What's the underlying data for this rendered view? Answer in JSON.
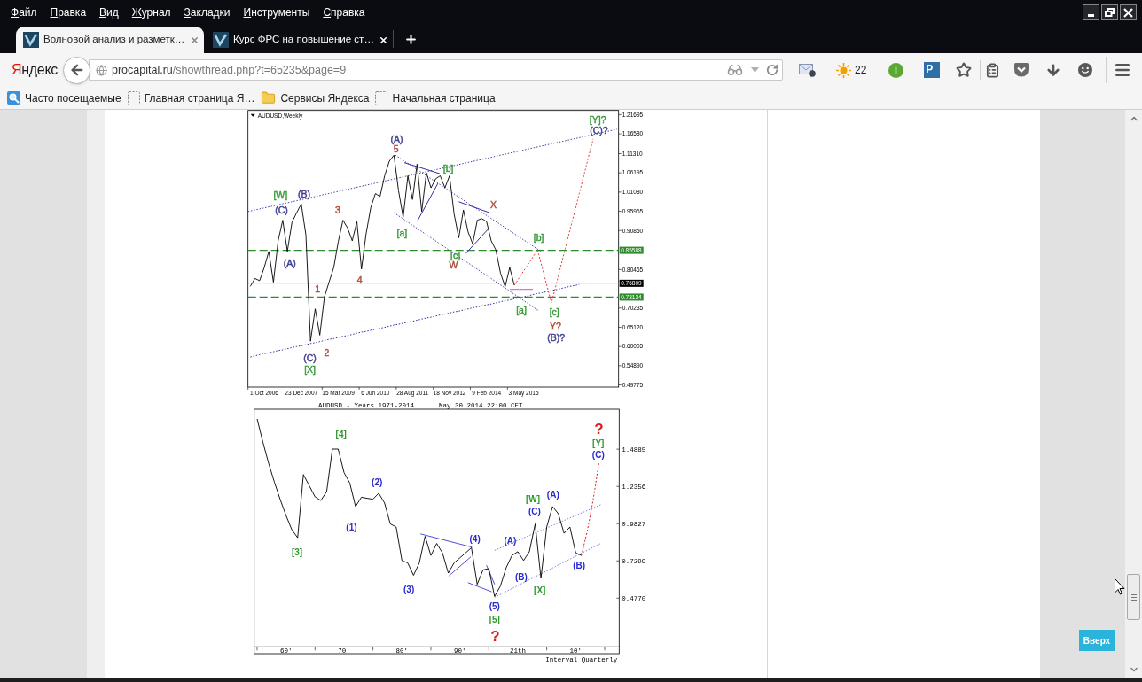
{
  "menu_bar": {
    "items": [
      "Файл",
      "Правка",
      "Вид",
      "Журнал",
      "Закладки",
      "Инструменты",
      "Справка"
    ]
  },
  "tabs": [
    {
      "title": "Волновой анализ и разметк…",
      "selected": true
    },
    {
      "title": "Курс ФРС на повышение ст…",
      "selected": false
    }
  ],
  "nav_bar": {
    "logo": "Яндекс",
    "url_host": "procapital.ru",
    "url_path": "/showthread.php?t=65235&page=9",
    "weather_temperature": "22",
    "extension_letter": "P"
  },
  "bookmarks": [
    {
      "label": "Часто посещаемые",
      "kind": "smart"
    },
    {
      "label": "Главная страница Я…",
      "kind": "page"
    },
    {
      "label": "Сервисы Яндекса",
      "kind": "folder"
    },
    {
      "label": "Начальная страница",
      "kind": "page"
    }
  ],
  "post": {
    "charts": [
      {
        "kind": "terminal",
        "chart_data": {
          "type": "line",
          "title": "AUDUSD,Weekly",
          "categories": [
            null,
            null,
            null,
            "1 Oct 2006",
            null,
            null,
            null,
            null,
            null,
            null,
            null,
            "23 Dec 2007",
            null,
            null,
            null,
            null,
            null,
            null,
            null,
            "15 Mar 2009",
            null,
            null,
            null,
            null,
            null,
            null,
            null,
            "6 Jun 2010",
            null,
            null,
            null,
            null,
            null,
            null,
            null,
            "28 Aug 2011",
            null,
            null,
            null,
            null,
            null,
            null,
            null,
            "18 Nov 2012",
            null,
            null,
            null,
            null,
            null,
            null,
            null,
            "9 Feb 2014",
            null,
            null,
            null,
            null,
            null,
            null,
            null,
            "3 May 2015",
            null,
            null,
            null,
            null,
            null,
            null,
            null,
            null,
            null,
            null,
            null,
            null,
            null,
            null,
            null,
            null,
            null,
            null,
            null,
            null
          ],
          "series": [
            {
              "color": "#000000",
              "line_style": "solid",
              "values": [
                0.76,
                0.781,
                0.775,
                0.81,
                0.853,
                0.771,
                0.881,
                0.936,
                0.853,
                0.93,
                0.956,
                0.979,
                0.897,
                0.614,
                0.7,
                0.63,
                0.732,
                0.771,
                0.81,
                0.88,
                0.936,
                0.915,
                0.881,
                0.932,
                0.806,
                0.9,
                0.97,
                1.007,
                0.999,
                1.054,
                1.093,
                1.109,
                1.014,
                0.944,
                1.054,
                0.991,
                1.085,
                0.959,
                1.062,
                1.022,
                1.046,
                1.054,
                1.022,
                1.054,
                0.952,
                0.889,
                0.963,
                0.905,
                0.873,
                0.936,
                0.94,
                0.932,
                0.881,
                0.857,
                0.795,
                0.759,
                0.81,
                0.763,
                null,
                null,
                null,
                null,
                null,
                null,
                null,
                null,
                null,
                null,
                null,
                null,
                null,
                null,
                null,
                null,
                null,
                null,
                null,
                null,
                null,
                null
              ]
            },
            {
              "color": "#e04040",
              "line_style": "dashed",
              "values": [
                null,
                null,
                null,
                null,
                null,
                null,
                null,
                null,
                null,
                null,
                null,
                null,
                null,
                null,
                null,
                null,
                null,
                null,
                null,
                null,
                null,
                null,
                null,
                null,
                null,
                null,
                null,
                null,
                null,
                null,
                null,
                null,
                null,
                null,
                null,
                null,
                null,
                null,
                null,
                null,
                null,
                null,
                null,
                null,
                null,
                null,
                null,
                null,
                null,
                null,
                null,
                null,
                null,
                null,
                null,
                null,
                null,
                0.763,
                0.782,
                0.801,
                0.819,
                0.838,
                0.857,
                0.81,
                0.763,
                0.716,
                0.764,
                0.813,
                0.861,
                0.91,
                0.958,
                1.007,
                1.055,
                1.104,
                1.152,
                null,
                null,
                null,
                null,
                null
              ]
            },
            {
              "color": "#3030a0",
              "line_style": "dotted",
              "values": [
                0.572,
                0.575,
                0.578,
                0.581,
                0.583,
                0.586,
                0.589,
                0.591,
                0.594,
                0.597,
                0.6,
                0.602,
                0.605,
                0.608,
                0.61,
                0.613,
                0.616,
                0.619,
                0.621,
                0.624,
                0.627,
                0.629,
                0.632,
                0.635,
                0.638,
                0.64,
                0.643,
                0.646,
                0.648,
                0.651,
                0.654,
                0.657,
                0.659,
                0.662,
                0.665,
                0.667,
                0.67,
                0.673,
                0.676,
                0.678,
                0.681,
                0.684,
                0.686,
                0.689,
                0.692,
                0.694,
                0.697,
                0.7,
                0.703,
                0.705,
                0.708,
                0.711,
                0.713,
                0.716,
                0.719,
                0.722,
                0.724,
                0.727,
                0.73,
                0.732,
                0.735,
                0.738,
                0.741,
                0.743,
                0.746,
                0.749,
                0.751,
                0.754,
                0.757,
                0.76,
                0.762,
                0.765,
                null,
                null,
                null,
                null,
                null,
                null,
                null,
                null
              ]
            },
            {
              "color": "#e040e0",
              "line_style": "solid",
              "values": [
                null,
                null,
                null,
                null,
                null,
                null,
                null,
                null,
                null,
                null,
                null,
                null,
                null,
                null,
                null,
                null,
                null,
                null,
                null,
                null,
                null,
                null,
                null,
                null,
                null,
                null,
                null,
                null,
                null,
                null,
                null,
                null,
                null,
                null,
                null,
                null,
                null,
                null,
                null,
                null,
                null,
                null,
                null,
                null,
                null,
                null,
                null,
                null,
                null,
                null,
                null,
                null,
                null,
                null,
                null,
                null,
                0.752,
                0.752,
                0.752,
                0.752,
                0.752,
                0.752,
                null,
                null,
                null,
                null,
                null,
                null,
                null,
                null,
                null,
                null,
                null,
                null,
                null,
                null,
                null,
                null,
                null,
                null
              ]
            }
          ],
          "ylim": [
            0.492,
            1.228
          ],
          "yticks": [
            {
              "value": 1.21695,
              "label": "1.21695"
            },
            {
              "value": 1.1658,
              "label": "1.16580"
            },
            {
              "value": 1.1131,
              "label": "1.11310"
            },
            {
              "value": 1.06195,
              "label": "1.06195"
            },
            {
              "value": 1.0108,
              "label": "1.01080"
            },
            {
              "value": 0.95965,
              "label": "0.95965"
            },
            {
              "value": 0.9085,
              "label": "0.90850"
            },
            {
              "value": 0.80465,
              "label": "0.80465"
            },
            {
              "value": 0.70235,
              "label": "0.70235"
            },
            {
              "value": 0.6512,
              "label": "0.65120"
            },
            {
              "value": 0.60005,
              "label": "0.60005"
            },
            {
              "value": 0.5489,
              "label": "0.54890"
            },
            {
              "value": 0.49775,
              "label": "0.49775"
            }
          ],
          "ref_lines": [
            {
              "axis": "y",
              "value": 0.85588,
              "label": "0.85588",
              "color": "#2e8b2e",
              "line_style": "dashed"
            },
            {
              "axis": "y",
              "value": 0.76809,
              "label": "0.76809",
              "color": "#c4c4c4",
              "line_style": "solid"
            },
            {
              "axis": "y",
              "value": 0.73134,
              "label": "0.73134",
              "color": "#2e8b2e",
              "line_style": "dashed"
            }
          ]
        },
        "wave_labels": [
          {
            "kind": "wave",
            "text": "[Y]?",
            "color": "#3a9a3a"
          },
          {
            "kind": "wave",
            "text": "(C)?",
            "color": "#404090"
          },
          {
            "kind": "wave",
            "text": "(A)",
            "color": "#404090"
          },
          {
            "kind": "wave",
            "text": "5",
            "color": "#b04a3a"
          },
          {
            "kind": "wave",
            "text": "[b]",
            "color": "#3a9a3a"
          },
          {
            "kind": "wave",
            "text": "[W]",
            "color": "#3a9a3a"
          },
          {
            "kind": "wave",
            "text": "(B)",
            "color": "#404090"
          },
          {
            "kind": "wave",
            "text": "(C)",
            "color": "#404090"
          },
          {
            "kind": "wave",
            "text": "3",
            "color": "#b04a3a"
          },
          {
            "kind": "wave",
            "text": "X",
            "color": "#b04a3a"
          },
          {
            "kind": "wave",
            "text": "[a]",
            "color": "#3a9a3a"
          },
          {
            "kind": "wave",
            "text": "[b]",
            "color": "#3a9a3a"
          },
          {
            "kind": "wave",
            "text": "[c]",
            "color": "#3a9a3a"
          },
          {
            "kind": "wave",
            "text": "W",
            "color": "#b04a3a"
          },
          {
            "kind": "wave",
            "text": "(A)",
            "color": "#404090"
          },
          {
            "kind": "wave",
            "text": "4",
            "color": "#b04a3a"
          },
          {
            "kind": "wave",
            "text": "1",
            "color": "#b04a3a"
          },
          {
            "kind": "wave",
            "text": "[a]",
            "color": "#3a9a3a"
          },
          {
            "kind": "wave",
            "text": "[c]",
            "color": "#3a9a3a"
          },
          {
            "kind": "wave",
            "text": "Y?",
            "color": "#b04a3a"
          },
          {
            "kind": "wave",
            "text": "(B)?",
            "color": "#404090"
          },
          {
            "kind": "wave",
            "text": "2",
            "color": "#b04a3a"
          },
          {
            "kind": "wave",
            "text": "(C)",
            "color": "#404090"
          },
          {
            "kind": "wave",
            "text": "[X]",
            "color": "#3a9a3a"
          }
        ]
      },
      {
        "kind": "classic",
        "chart_data": {
          "type": "line",
          "title": "AUDUSD - Years 1971-2014",
          "subtitle": "May 30 2014 22:00 CET",
          "xlabel": "Interval Quarterly",
          "categories": [
            null,
            null,
            null,
            null,
            null,
            "60'",
            null,
            null,
            null,
            null,
            null,
            null,
            null,
            null,
            null,
            "70'",
            null,
            null,
            null,
            null,
            null,
            null,
            null,
            null,
            null,
            "80'",
            null,
            null,
            null,
            null,
            null,
            null,
            null,
            null,
            null,
            "90'",
            null,
            null,
            null,
            null,
            null,
            null,
            null,
            null,
            null,
            "21th",
            null,
            null,
            null,
            null,
            null,
            null,
            null,
            null,
            null,
            "10'",
            null,
            null,
            null,
            null,
            null,
            null,
            null
          ],
          "series": [
            {
              "color": "#000000",
              "line_style": "solid",
              "values": [
                1.694,
                1.536,
                1.392,
                1.262,
                1.145,
                1.038,
                0.941,
                0.887,
                1.316,
                1.24,
                1.165,
                1.14,
                1.2,
                1.489,
                1.489,
                1.33,
                1.258,
                1.099,
                1.162,
                1.155,
                1.149,
                1.189,
                1.123,
                0.981,
                0.96,
                0.732,
                0.716,
                0.632,
                0.716,
                0.897,
                0.766,
                0.848,
                0.784,
                0.647,
                0.716,
                0.75,
                0.784,
                0.82,
                0.571,
                0.669,
                0.677,
                0.488,
                0.559,
                0.684,
                0.766,
                0.792,
                0.732,
                0.792,
                0.981,
                0.611,
                0.96,
                1.099,
                1.05,
                0.917,
                0.96,
                0.784,
                0.766,
                null,
                null,
                null,
                null,
                null,
                null
              ]
            },
            {
              "color": "#e02020",
              "line_style": "dashed",
              "values": [
                null,
                null,
                null,
                null,
                null,
                null,
                null,
                null,
                null,
                null,
                null,
                null,
                null,
                null,
                null,
                null,
                null,
                null,
                null,
                null,
                null,
                null,
                null,
                null,
                null,
                null,
                null,
                null,
                null,
                null,
                null,
                null,
                null,
                null,
                null,
                null,
                null,
                null,
                null,
                null,
                null,
                null,
                null,
                null,
                null,
                null,
                null,
                null,
                null,
                null,
                null,
                null,
                null,
                null,
                null,
                null,
                0.766,
                0.934,
                1.141,
                1.392,
                null,
                null,
                null
              ]
            }
          ],
          "ylim": [
            0.146,
            1.76
          ],
          "yticks": [
            {
              "value": 1.4885,
              "label": "1.4885"
            },
            {
              "value": 1.2356,
              "label": "1.2356"
            },
            {
              "value": 0.9827,
              "label": "0.9827"
            },
            {
              "value": 0.7299,
              "label": "0.7299"
            },
            {
              "value": 0.477,
              "label": "0.4770"
            }
          ]
        },
        "wave_labels": [
          {
            "kind": "mark",
            "text": "?",
            "color": "#e01a1a"
          },
          {
            "kind": "wave",
            "text": "[4]",
            "color": "#2a9a2a"
          },
          {
            "kind": "wave",
            "text": "[Y]",
            "color": "#2a9a2a"
          },
          {
            "kind": "wave",
            "text": "(C)",
            "color": "#2a2ad0"
          },
          {
            "kind": "wave",
            "text": "(2)",
            "color": "#2a2ad0"
          },
          {
            "kind": "wave",
            "text": "(A)",
            "color": "#2a2ad0"
          },
          {
            "kind": "wave",
            "text": "[W]",
            "color": "#2a9a2a"
          },
          {
            "kind": "wave",
            "text": "(C)",
            "color": "#2a2ad0"
          },
          {
            "kind": "wave",
            "text": "(1)",
            "color": "#2a2ad0"
          },
          {
            "kind": "wave",
            "text": "(4)",
            "color": "#2a2ad0"
          },
          {
            "kind": "wave",
            "text": "(A)",
            "color": "#2a2ad0"
          },
          {
            "kind": "wave",
            "text": "[3]",
            "color": "#2a9a2a"
          },
          {
            "kind": "wave",
            "text": "(B)",
            "color": "#2a2ad0"
          },
          {
            "kind": "wave",
            "text": "(B)",
            "color": "#2a2ad0"
          },
          {
            "kind": "wave",
            "text": "(3)",
            "color": "#2a2ad0"
          },
          {
            "kind": "wave",
            "text": "[X]",
            "color": "#2a9a2a"
          },
          {
            "kind": "wave",
            "text": "(5)",
            "color": "#2a2ad0"
          },
          {
            "kind": "wave",
            "text": "[5]",
            "color": "#2a9a2a"
          },
          {
            "kind": "mark",
            "text": "?",
            "color": "#e01a1a"
          }
        ]
      }
    ]
  },
  "scroll_top_button": "Вверх"
}
